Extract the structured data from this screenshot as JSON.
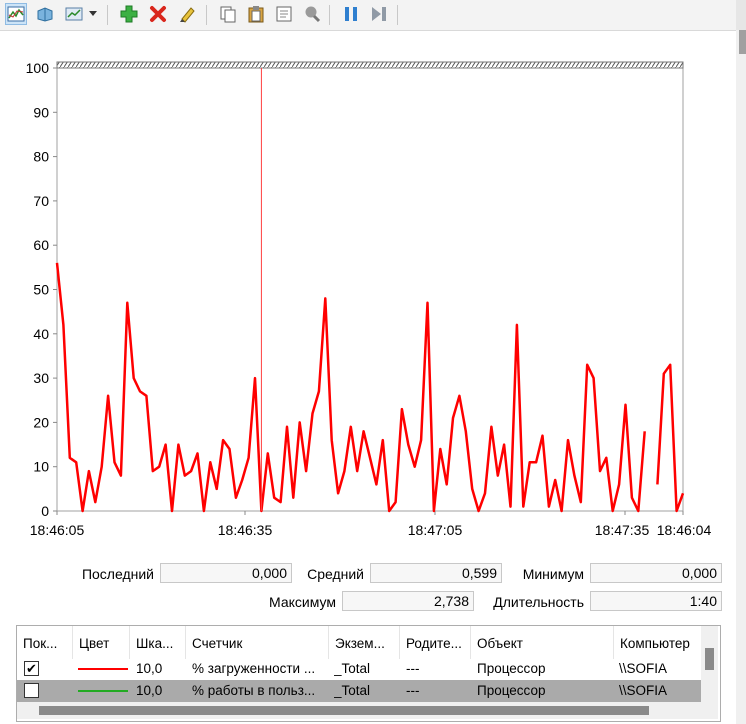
{
  "toolbar": {
    "icons": [
      "view-graph-icon",
      "view-histogram-icon",
      "view-report-icon",
      "dropdown-arrow-icon",
      "add-counter-icon",
      "delete-counter-icon",
      "highlight-icon",
      "copy-properties-icon",
      "paste-counters-icon",
      "properties-icon",
      "zoom-icon",
      "freeze-display-icon",
      "update-data-icon"
    ]
  },
  "chart_data": {
    "type": "line",
    "ylim": [
      0,
      100
    ],
    "yticks": [
      "100",
      "90",
      "80",
      "70",
      "60",
      "50",
      "40",
      "30",
      "20",
      "10",
      "0"
    ],
    "xticks": [
      "18:46:05",
      "18:46:35",
      "18:47:05",
      "18:47:35",
      "18:46:04"
    ],
    "time_cursor_index": 32,
    "series": [
      {
        "name": "% загруженности ...",
        "color": "#ff0000",
        "values": [
          56,
          42,
          12,
          11,
          0,
          9,
          2,
          10,
          26,
          11,
          8,
          47,
          30,
          27,
          26,
          9,
          10,
          15,
          0,
          15,
          8,
          9,
          13,
          0,
          11,
          5,
          16,
          14,
          3,
          7,
          12,
          30,
          0,
          13,
          3,
          2,
          19,
          3,
          20,
          9,
          22,
          27,
          48,
          16,
          4,
          9,
          19,
          9,
          18,
          12,
          6,
          16,
          0,
          2,
          23,
          15,
          10,
          16,
          47,
          0,
          14,
          6,
          21,
          26,
          18,
          5,
          0,
          4,
          19,
          8,
          15,
          1,
          42,
          1,
          11,
          11,
          17,
          1,
          7,
          0,
          16,
          8,
          2,
          33,
          30,
          9,
          12,
          0,
          6,
          24,
          3,
          0,
          18,
          null,
          6,
          31,
          33,
          0,
          4
        ]
      }
    ]
  },
  "stats": {
    "last_label": "Последний",
    "last_value": "0,000",
    "avg_label": "Средний",
    "avg_value": "0,599",
    "min_label": "Минимум",
    "min_value": "0,000",
    "max_label": "Максимум",
    "max_value": "2,738",
    "dur_label": "Длительность",
    "dur_value": "1:40"
  },
  "legend": {
    "headers": [
      "Пок...",
      "Цвет",
      "Шка...",
      "Счетчик",
      "Экзем...",
      "Родите...",
      "Объект",
      "Компьютер"
    ],
    "rows": [
      {
        "checked": true,
        "check_mark": "✔",
        "color": "#ff0000",
        "scale": "10,0",
        "counter": "% загруженности ...",
        "instance": "_Total",
        "parent": "---",
        "object": "Процессор",
        "computer": "\\\\SOFIA"
      },
      {
        "checked": false,
        "check_mark": "",
        "color": "#22aa22",
        "scale": "10,0",
        "counter": "% работы в польз...",
        "instance": "_Total",
        "parent": "---",
        "object": "Процессор",
        "computer": "\\\\SOFIA"
      }
    ]
  }
}
